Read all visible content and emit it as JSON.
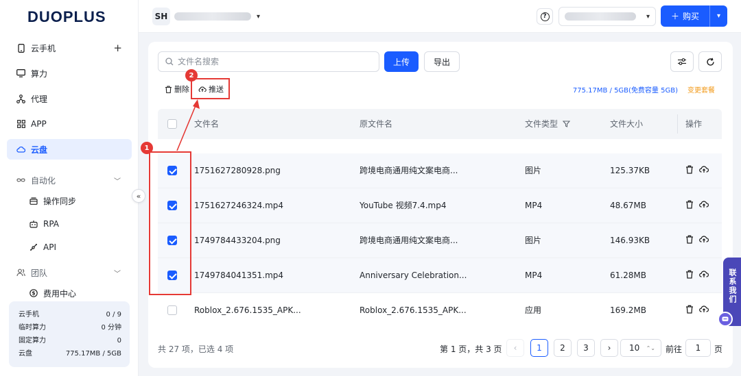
{
  "brand": {
    "logo_text": "DUOPLUS"
  },
  "sidebar": {
    "items": [
      {
        "label": "云手机",
        "icon": "phone-icon",
        "trailing": "+"
      },
      {
        "label": "算力",
        "icon": "monitor-icon"
      },
      {
        "label": "代理",
        "icon": "network-icon"
      },
      {
        "label": "APP",
        "icon": "grid-icon"
      },
      {
        "label": "云盘",
        "icon": "cloud-icon",
        "active": true
      },
      {
        "label": "自动化",
        "icon": "infinity-icon",
        "group": true
      },
      {
        "label": "操作同步",
        "icon": "sync-icon",
        "sub": true
      },
      {
        "label": "RPA",
        "icon": "robot-icon",
        "sub": true
      },
      {
        "label": "API",
        "icon": "api-icon",
        "sub": true
      },
      {
        "label": "团队",
        "icon": "team-icon",
        "group": true
      },
      {
        "label": "费用中心",
        "icon": "dollar-icon",
        "sub": true
      }
    ],
    "stats": [
      {
        "label": "云手机",
        "value": "0 / 9"
      },
      {
        "label": "临时算力",
        "value": "0 分钟"
      },
      {
        "label": "固定算力",
        "value": "0"
      },
      {
        "label": "云盘",
        "value": "775.17MB / 5GB"
      }
    ],
    "collapse_glyph": "«"
  },
  "topbar": {
    "account_initials": "SH",
    "buy_label": "购买",
    "help_glyph": "?"
  },
  "toolbar": {
    "search_placeholder": "文件名搜索",
    "upload_label": "上传",
    "export_label": "导出",
    "delete_label": "删除",
    "push_label": "推送",
    "usage_text": "775.17MB / 5GB(免费容量 5GB)",
    "change_plan_label": "变更套餐"
  },
  "table": {
    "headers": {
      "name": "文件名",
      "origin": "原文件名",
      "type": "文件类型",
      "size": "文件大小",
      "ops": "操作"
    },
    "rows": [
      {
        "name": "1751627280928.png",
        "origin": "跨境电商通用纯文案电商...",
        "type": "图片",
        "size": "125.37KB",
        "checked": true
      },
      {
        "name": "1751627246324.mp4",
        "origin": "YouTube 视频7.4.mp4",
        "type": "MP4",
        "size": "48.67MB",
        "checked": true
      },
      {
        "name": "1749784433204.png",
        "origin": "跨境电商通用纯文案电商...",
        "type": "图片",
        "size": "146.93KB",
        "checked": true
      },
      {
        "name": "1749784041351.mp4",
        "origin": "Anniversary Celebration...",
        "type": "MP4",
        "size": "61.28MB",
        "checked": true
      },
      {
        "name": "Roblox_2.676.1535_APK...",
        "origin": "Roblox_2.676.1535_APK...",
        "type": "应用",
        "size": "169.2MB",
        "checked": false
      }
    ]
  },
  "pagination": {
    "total_text": "共 27 项，已选 4 项",
    "page_info": "第 1 页，共 3 页",
    "pages": [
      "1",
      "2",
      "3"
    ],
    "current_page": "1",
    "page_size": "10",
    "goto_label": "前往",
    "goto_value": "1",
    "page_suffix": "页"
  },
  "annotations": {
    "badge1": "1",
    "badge2": "2",
    "color": "#e53935"
  },
  "contact": {
    "label": "联系我们"
  },
  "colors": {
    "primary": "#1a5cff",
    "warning": "#f29a1a",
    "sidebar_active_bg": "#e8efff"
  }
}
